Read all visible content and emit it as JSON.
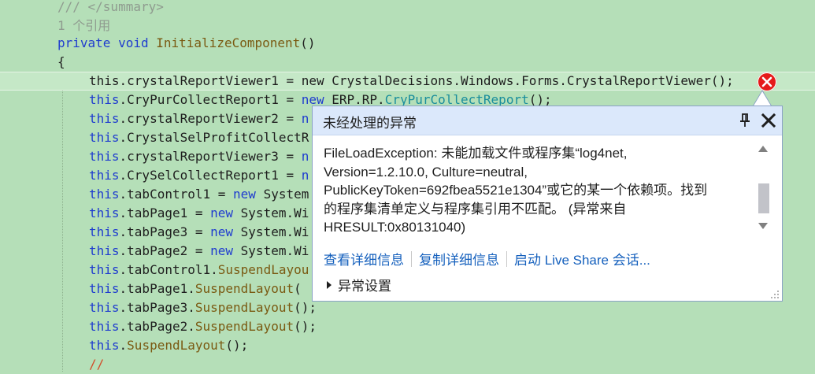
{
  "editor": {
    "lines": [
      {
        "segments": [
          {
            "t": "/// </summary>",
            "c": "gray"
          }
        ]
      },
      {
        "segments": [
          {
            "t": "1 个引用",
            "c": "gray"
          }
        ]
      },
      {
        "segments": [
          {
            "t": "private",
            "c": "kw"
          },
          {
            "t": " ",
            "c": ""
          },
          {
            "t": "void",
            "c": "kw"
          },
          {
            "t": " ",
            "c": ""
          },
          {
            "t": "InitializeComponent",
            "c": "mth"
          },
          {
            "t": "()",
            "c": ""
          }
        ]
      },
      {
        "segments": [
          {
            "t": "{",
            "c": ""
          }
        ]
      },
      {
        "segments": [
          {
            "t": "this.crystalReportViewer1 = new CrystalDecisions.Windows.Forms.CrystalReportViewer();",
            "c": ""
          }
        ]
      },
      {
        "segments": [
          {
            "t": "this",
            "c": "kw"
          },
          {
            "t": ".CryPurCollectReport1 = ",
            "c": ""
          },
          {
            "t": "new",
            "c": "kw"
          },
          {
            "t": " ERP.RP.",
            "c": ""
          },
          {
            "t": "CryPurCollectReport",
            "c": "cls"
          },
          {
            "t": "();",
            "c": ""
          }
        ]
      },
      {
        "segments": [
          {
            "t": "this",
            "c": "kw"
          },
          {
            "t": ".crystalReportViewer2 = ",
            "c": ""
          },
          {
            "t": "n",
            "c": "kw"
          }
        ]
      },
      {
        "segments": [
          {
            "t": "this",
            "c": "kw"
          },
          {
            "t": ".CrystalSelProfitCollectR",
            "c": ""
          }
        ]
      },
      {
        "segments": [
          {
            "t": "this",
            "c": "kw"
          },
          {
            "t": ".crystalReportViewer3 = ",
            "c": ""
          },
          {
            "t": "n",
            "c": "kw"
          }
        ]
      },
      {
        "segments": [
          {
            "t": "this",
            "c": "kw"
          },
          {
            "t": ".CrySelCollectReport1 = ",
            "c": ""
          },
          {
            "t": "n",
            "c": "kw"
          }
        ]
      },
      {
        "segments": [
          {
            "t": "this",
            "c": "kw"
          },
          {
            "t": ".tabControl1 = ",
            "c": ""
          },
          {
            "t": "new",
            "c": "kw"
          },
          {
            "t": " System",
            "c": ""
          }
        ]
      },
      {
        "segments": [
          {
            "t": "this",
            "c": "kw"
          },
          {
            "t": ".tabPage1 = ",
            "c": ""
          },
          {
            "t": "new",
            "c": "kw"
          },
          {
            "t": " System.Wi",
            "c": ""
          }
        ]
      },
      {
        "segments": [
          {
            "t": "this",
            "c": "kw"
          },
          {
            "t": ".tabPage3 = ",
            "c": ""
          },
          {
            "t": "new",
            "c": "kw"
          },
          {
            "t": " System.Wi",
            "c": ""
          }
        ]
      },
      {
        "segments": [
          {
            "t": "this",
            "c": "kw"
          },
          {
            "t": ".tabPage2 = ",
            "c": ""
          },
          {
            "t": "new",
            "c": "kw"
          },
          {
            "t": " System.Wi",
            "c": ""
          }
        ]
      },
      {
        "segments": [
          {
            "t": "this",
            "c": "kw"
          },
          {
            "t": ".tabControl1.",
            "c": ""
          },
          {
            "t": "SuspendLayou",
            "c": "mth"
          }
        ]
      },
      {
        "segments": [
          {
            "t": "this",
            "c": "kw"
          },
          {
            "t": ".tabPage1.",
            "c": ""
          },
          {
            "t": "SuspendLayout",
            "c": "mth"
          },
          {
            "t": "(",
            "c": ""
          }
        ]
      },
      {
        "segments": [
          {
            "t": "this",
            "c": "kw"
          },
          {
            "t": ".tabPage3.",
            "c": ""
          },
          {
            "t": "SuspendLayout",
            "c": "mth"
          },
          {
            "t": "();",
            "c": ""
          }
        ]
      },
      {
        "segments": [
          {
            "t": "this",
            "c": "kw"
          },
          {
            "t": ".tabPage2.",
            "c": ""
          },
          {
            "t": "SuspendLayout",
            "c": "mth"
          },
          {
            "t": "();",
            "c": ""
          }
        ]
      },
      {
        "segments": [
          {
            "t": "this",
            "c": "kw"
          },
          {
            "t": ".",
            "c": ""
          },
          {
            "t": "SuspendLayout",
            "c": "mth"
          },
          {
            "t": "();",
            "c": ""
          }
        ]
      },
      {
        "segments": [
          {
            "t": "//",
            "c": "cmt"
          }
        ]
      }
    ]
  },
  "popup": {
    "title": "未经处理的异常",
    "pin_icon": "pin-icon",
    "close_icon": "close-icon",
    "message_lines": [
      "FileLoadException: 未能加载文件或程序集“log4net,",
      "Version=1.2.10.0, Culture=neutral,",
      "PublicKeyToken=692fbea5521e1304”或它的某一个依赖项。找到",
      "的程序集清单定义与程序集引用不匹配。 (异常来自",
      "HRESULT:0x80131040)"
    ],
    "links": {
      "view_details": "查看详细信息",
      "copy_details": "复制详细信息",
      "live_share": "启动 Live Share 会话..."
    },
    "exception_settings": "异常设置"
  },
  "colors": {
    "editor_bg": "#b5dfb8",
    "error_red": "#e51a1a",
    "link_blue": "#1560bd",
    "header_bg": "#dbe8fb"
  }
}
